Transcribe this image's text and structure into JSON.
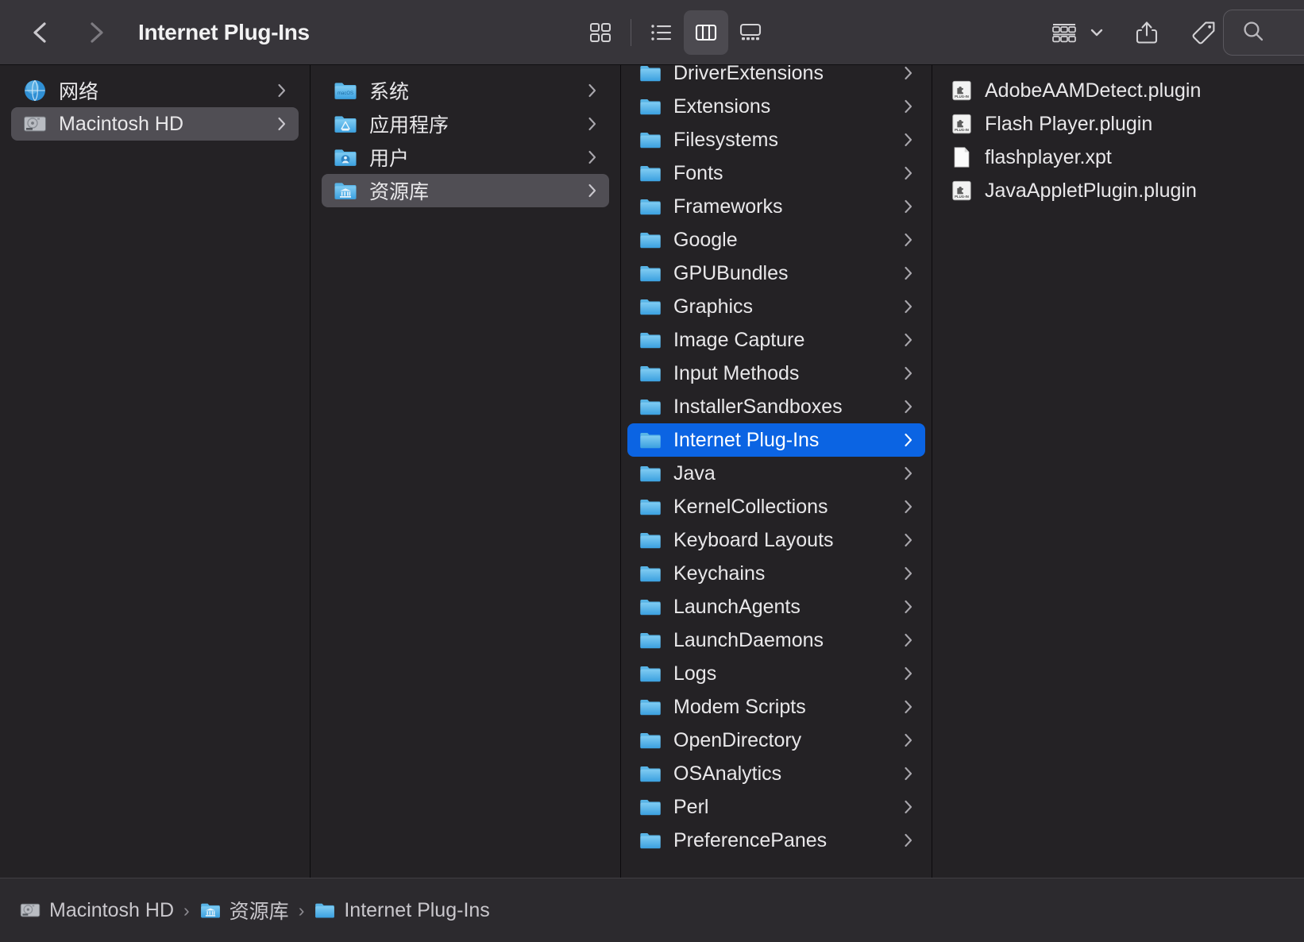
{
  "window": {
    "title": "Internet Plug-Ins",
    "accent_blue": "#0b64e3",
    "selection_gray": "#504e54",
    "toolbar_bg": "#37353a",
    "content_bg": "#242225",
    "pathbar_bg": "#2c2a2e"
  },
  "toolbar": {
    "back_icon": "chevron-left-icon",
    "forward_icon": "chevron-right-icon",
    "views": [
      {
        "name": "icon-view",
        "icon": "grid-icon",
        "active": false
      },
      {
        "name": "list-view",
        "icon": "list-icon",
        "active": false
      },
      {
        "name": "column-view",
        "icon": "columns-icon",
        "active": true
      },
      {
        "name": "gallery-view",
        "icon": "gallery-icon",
        "active": false
      }
    ],
    "group_by": {
      "name": "group-by-button",
      "icon": "group-icon",
      "chevron": "chevron-down-icon"
    },
    "share": {
      "name": "share-button",
      "icon": "share-icon"
    },
    "tag": {
      "name": "tag-button",
      "icon": "tag-icon"
    },
    "more": {
      "name": "more-button",
      "icon": "ellipsis-circle-icon",
      "chevron": "chevron-down-icon"
    },
    "search": {
      "name": "search-field",
      "icon": "search-icon",
      "placeholder": "",
      "value": ""
    }
  },
  "columns": [
    {
      "name": "column-devices",
      "items": [
        {
          "label": "网络",
          "icon": "network-globe-icon",
          "disclosure": true,
          "selected": false
        },
        {
          "label": "Macintosh HD",
          "icon": "hard-drive-icon",
          "disclosure": true,
          "selected": "gray"
        }
      ]
    },
    {
      "name": "column-volume-root",
      "items": [
        {
          "label": "系统",
          "icon": "folder-macos-icon",
          "disclosure": true,
          "selected": false
        },
        {
          "label": "应用程序",
          "icon": "folder-applications-icon",
          "disclosure": true,
          "selected": false
        },
        {
          "label": "用户",
          "icon": "folder-users-icon",
          "disclosure": true,
          "selected": false
        },
        {
          "label": "资源库",
          "icon": "folder-library-icon",
          "disclosure": true,
          "selected": "gray"
        }
      ]
    },
    {
      "name": "column-library",
      "scrolled": true,
      "items": [
        {
          "label": "DriverExtensions",
          "icon": "folder-icon",
          "disclosure": true,
          "selected": false
        },
        {
          "label": "Extensions",
          "icon": "folder-icon",
          "disclosure": true,
          "selected": false
        },
        {
          "label": "Filesystems",
          "icon": "folder-icon",
          "disclosure": true,
          "selected": false
        },
        {
          "label": "Fonts",
          "icon": "folder-icon",
          "disclosure": true,
          "selected": false
        },
        {
          "label": "Frameworks",
          "icon": "folder-icon",
          "disclosure": true,
          "selected": false
        },
        {
          "label": "Google",
          "icon": "folder-icon",
          "disclosure": true,
          "selected": false
        },
        {
          "label": "GPUBundles",
          "icon": "folder-icon",
          "disclosure": true,
          "selected": false
        },
        {
          "label": "Graphics",
          "icon": "folder-icon",
          "disclosure": true,
          "selected": false
        },
        {
          "label": "Image Capture",
          "icon": "folder-icon",
          "disclosure": true,
          "selected": false
        },
        {
          "label": "Input Methods",
          "icon": "folder-icon",
          "disclosure": true,
          "selected": false
        },
        {
          "label": "InstallerSandboxes",
          "icon": "folder-icon",
          "disclosure": true,
          "selected": false
        },
        {
          "label": "Internet Plug-Ins",
          "icon": "folder-icon",
          "disclosure": true,
          "selected": "blue"
        },
        {
          "label": "Java",
          "icon": "folder-icon",
          "disclosure": true,
          "selected": false
        },
        {
          "label": "KernelCollections",
          "icon": "folder-icon",
          "disclosure": true,
          "selected": false
        },
        {
          "label": "Keyboard Layouts",
          "icon": "folder-icon",
          "disclosure": true,
          "selected": false
        },
        {
          "label": "Keychains",
          "icon": "folder-icon",
          "disclosure": true,
          "selected": false
        },
        {
          "label": "LaunchAgents",
          "icon": "folder-icon",
          "disclosure": true,
          "selected": false
        },
        {
          "label": "LaunchDaemons",
          "icon": "folder-icon",
          "disclosure": true,
          "selected": false
        },
        {
          "label": "Logs",
          "icon": "folder-icon",
          "disclosure": true,
          "selected": false
        },
        {
          "label": "Modem Scripts",
          "icon": "folder-icon",
          "disclosure": true,
          "selected": false
        },
        {
          "label": "OpenDirectory",
          "icon": "folder-icon",
          "disclosure": true,
          "selected": false
        },
        {
          "label": "OSAnalytics",
          "icon": "folder-icon",
          "disclosure": true,
          "selected": false
        },
        {
          "label": "Perl",
          "icon": "folder-icon",
          "disclosure": true,
          "selected": false
        },
        {
          "label": "PreferencePanes",
          "icon": "folder-icon",
          "disclosure": true,
          "selected": false
        }
      ]
    },
    {
      "name": "column-internet-plugins",
      "items": [
        {
          "label": "AdobeAAMDetect.plugin",
          "icon": "plugin-icon",
          "disclosure": false,
          "selected": false
        },
        {
          "label": "Flash Player.plugin",
          "icon": "plugin-icon",
          "disclosure": false,
          "selected": false
        },
        {
          "label": "flashplayer.xpt",
          "icon": "document-icon",
          "disclosure": false,
          "selected": false
        },
        {
          "label": "JavaAppletPlugin.plugin",
          "icon": "plugin-icon",
          "disclosure": false,
          "selected": false
        }
      ]
    }
  ],
  "pathbar": {
    "name": "breadcrumb",
    "separator": "›",
    "crumbs": [
      {
        "label": "Macintosh HD",
        "icon": "hard-drive-icon"
      },
      {
        "label": "资源库",
        "icon": "folder-library-icon"
      },
      {
        "label": "Internet Plug-Ins",
        "icon": "folder-icon"
      }
    ]
  }
}
